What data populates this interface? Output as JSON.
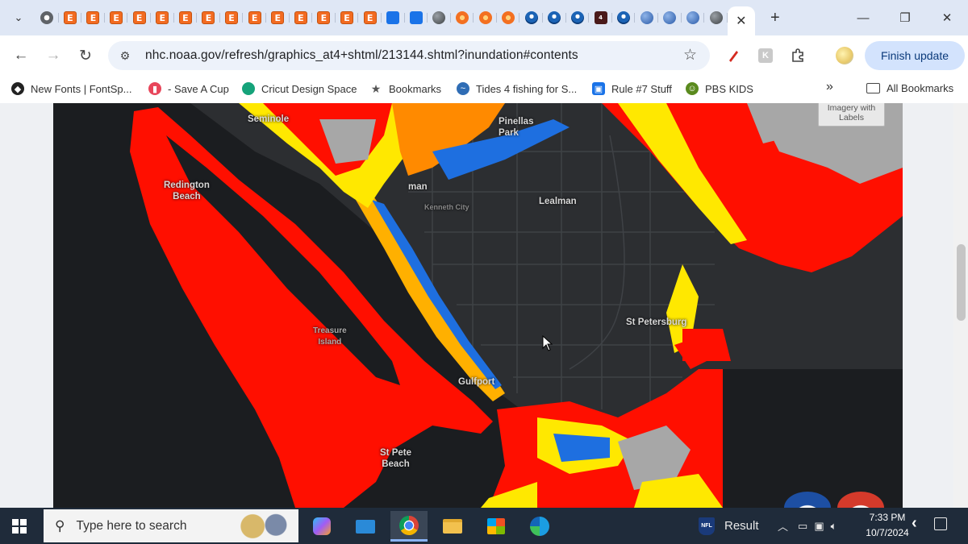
{
  "browser": {
    "tabs": [
      {
        "icon": "chrome-icon"
      },
      {
        "icon": "e-icon",
        "label": "E"
      },
      {
        "icon": "e-icon",
        "label": "E"
      },
      {
        "icon": "e-icon",
        "label": "E"
      },
      {
        "icon": "e-icon",
        "label": "E"
      },
      {
        "icon": "e-icon",
        "label": "E"
      },
      {
        "icon": "e-icon",
        "label": "E"
      },
      {
        "icon": "e-icon",
        "label": "E"
      },
      {
        "icon": "e-icon",
        "label": "E"
      },
      {
        "icon": "e-icon",
        "label": "E"
      },
      {
        "icon": "e-icon",
        "label": "E"
      },
      {
        "icon": "e-icon",
        "label": "E"
      },
      {
        "icon": "e-icon",
        "label": "E"
      },
      {
        "icon": "e-icon",
        "label": "E"
      },
      {
        "icon": "e-icon",
        "label": "E"
      },
      {
        "icon": "shopping-bag-icon"
      },
      {
        "icon": "shopping-bag-icon"
      },
      {
        "icon": "globe-icon"
      },
      {
        "icon": "sun-icon"
      },
      {
        "icon": "sun-icon"
      },
      {
        "icon": "sun-icon"
      },
      {
        "icon": "noaa-icon"
      },
      {
        "icon": "noaa-icon"
      },
      {
        "icon": "noaa-icon"
      },
      {
        "icon": "news-icon",
        "label": "4"
      },
      {
        "icon": "noaa-icon"
      },
      {
        "icon": "blue-globe-icon"
      },
      {
        "icon": "blue-globe-icon"
      },
      {
        "icon": "blue-globe-icon"
      },
      {
        "icon": "globe-icon"
      }
    ],
    "url": "nhc.noaa.gov/refresh/graphics_at4+shtml/213144.shtml?inundation#contents",
    "finish_update_label": "Finish update",
    "bookmarks": [
      {
        "label": "New Fonts | FontSp...",
        "color": "#222222"
      },
      {
        "label": "- Save A Cup",
        "color": "#e8455a"
      },
      {
        "label": "Cricut Design Space",
        "color": "#15a37a"
      },
      {
        "label": "Bookmarks",
        "color": "#555555"
      },
      {
        "label": "Tides 4 fishing for S...",
        "color": "#2f6db5"
      },
      {
        "label": "Rule #7 Stuff",
        "color": "#1a73e8"
      },
      {
        "label": "PBS KIDS",
        "color": "#5a8a1e"
      }
    ],
    "bookmarks_overflow": "»",
    "all_bookmarks_label": "All Bookmarks"
  },
  "map": {
    "labels": {
      "seminole": "Seminole",
      "pinellas_park": "Pinellas\nPark",
      "redington_beach": "Redington\nBeach",
      "lealman": "Lealman",
      "kenneth_city": "Kenneth City",
      "st_petersburg": "St Petersburg",
      "gulfport": "Gulfport",
      "st_pete_beach": "St Pete\nBeach",
      "treasure_island": "Treasure\nIsland",
      "lealman_partial": "man"
    },
    "basemap_toggle": "Imagery with\nLabels",
    "colors": {
      "red": "#ff0f00",
      "orange": "#ff8a00",
      "yellow": "#ffe800",
      "blue": "#1e6fe0",
      "gray": "#a7a7a7"
    }
  },
  "taskbar": {
    "search_placeholder": "Type here to search",
    "news_label": "Result",
    "time": "7:33 PM",
    "date": "10/7/2024"
  }
}
